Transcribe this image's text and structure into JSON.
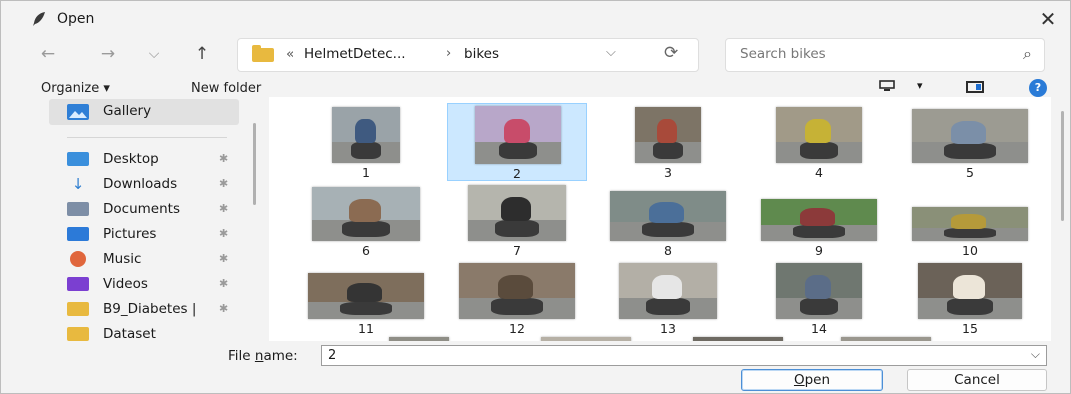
{
  "window": {
    "title": "Open",
    "close_glyph": "✕"
  },
  "nav": {
    "back": "←",
    "forward": "→",
    "recent": "⌵",
    "up": "↑"
  },
  "address": {
    "prefix": "«",
    "crumbs": [
      "HelmetDetec...",
      "bikes"
    ],
    "separator": "›",
    "dropdown_glyph": "⌵",
    "refresh_glyph": "⟳"
  },
  "search": {
    "placeholder": "Search bikes",
    "icon_glyph": "⌕"
  },
  "toolbar": {
    "organize": "Organize ▾",
    "new_folder": "New folder",
    "view_dd": "▾",
    "help": "?"
  },
  "sidebar": {
    "gallery": "Gallery",
    "items": [
      {
        "label": "Desktop",
        "icon": "desktop-icon",
        "color": "#3a8fdc",
        "pinned": true
      },
      {
        "label": "Downloads",
        "icon": "download-icon",
        "color": "#2f7fd0",
        "pinned": true
      },
      {
        "label": "Documents",
        "icon": "documents-icon",
        "color": "#7d8ea6",
        "pinned": true
      },
      {
        "label": "Pictures",
        "icon": "pictures-icon",
        "color": "#2c7ad8",
        "pinned": true
      },
      {
        "label": "Music",
        "icon": "music-icon",
        "color": "#e0663c",
        "pinned": true
      },
      {
        "label": "Videos",
        "icon": "videos-icon",
        "color": "#7b3fd1",
        "pinned": true
      },
      {
        "label": "B9_Diabetes |",
        "icon": "folder-icon",
        "color": "#e8b93f",
        "pinned": true
      },
      {
        "label": "Dataset",
        "icon": "folder-icon",
        "color": "#e8b93f",
        "pinned": false
      }
    ],
    "pin_glyph": "📌"
  },
  "files": [
    {
      "label": "1",
      "bg": "#9aa3a8",
      "rider": "#3f5a80",
      "selected": false
    },
    {
      "label": "2",
      "bg": "#b8a7c9",
      "rider": "#c84c6a",
      "selected": true
    },
    {
      "label": "3",
      "bg": "#7d7466",
      "rider": "#a84a3a",
      "selected": false
    },
    {
      "label": "4",
      "bg": "#a19a88",
      "rider": "#c6b236",
      "selected": false
    },
    {
      "label": "5",
      "bg": "#9c9b92",
      "rider": "#7b8fa8",
      "selected": false
    },
    {
      "label": "6",
      "bg": "#a7b1b5",
      "rider": "#8b6b52",
      "selected": false
    },
    {
      "label": "7",
      "bg": "#b5b5ad",
      "rider": "#2d2d2d",
      "selected": false
    },
    {
      "label": "8",
      "bg": "#7f8c88",
      "rider": "#4b6f99",
      "selected": false
    },
    {
      "label": "9",
      "bg": "#5f8a4e",
      "rider": "#8c3a3a",
      "selected": false
    },
    {
      "label": "10",
      "bg": "#8a9078",
      "rider": "#b59a3a",
      "selected": false
    },
    {
      "label": "11",
      "bg": "#7e6e5c",
      "rider": "#343434",
      "selected": false
    },
    {
      "label": "12",
      "bg": "#8a7a6a",
      "rider": "#5a4b3c",
      "selected": false
    },
    {
      "label": "13",
      "bg": "#b3afa6",
      "rider": "#e6e6e6",
      "selected": false
    },
    {
      "label": "14",
      "bg": "#6f7770",
      "rider": "#5b6d88",
      "selected": false
    },
    {
      "label": "15",
      "bg": "#6b6258",
      "rider": "#ece5d8",
      "selected": false
    }
  ],
  "footer": {
    "file_name_label": "File name:",
    "file_name_value": "2",
    "dropdown_glyph": "⌵",
    "open": "Open",
    "cancel": "Cancel"
  }
}
